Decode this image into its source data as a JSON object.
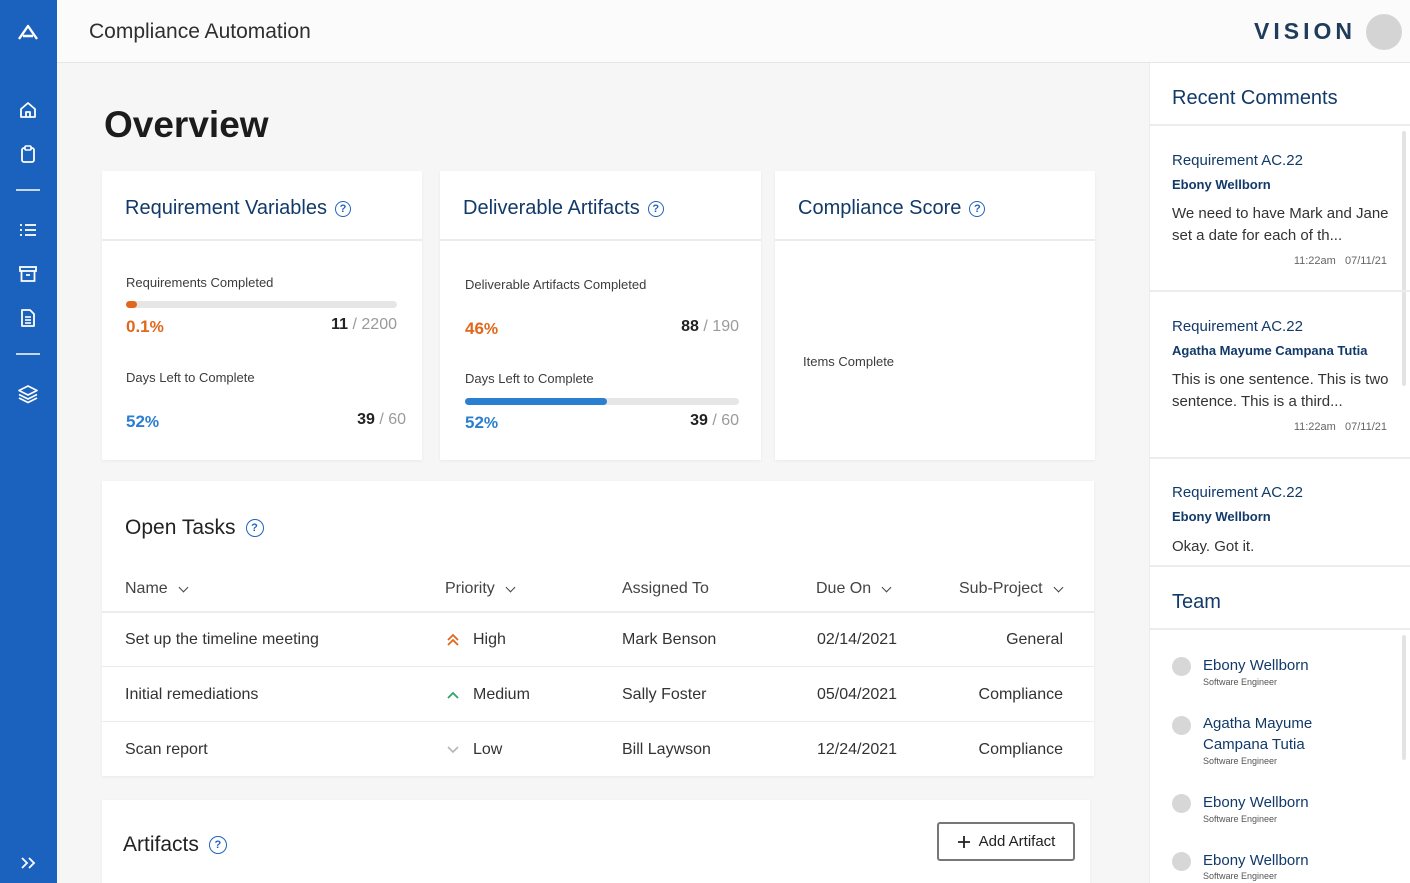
{
  "app": {
    "title": "Compliance Automation",
    "brand": "VISION"
  },
  "sidebar": {
    "icons": [
      "logo-icon",
      "home-icon",
      "clipboard-icon",
      "list-icon",
      "archive-icon",
      "document-icon",
      "layers-icon",
      "expand-icon"
    ]
  },
  "page": {
    "title": "Overview"
  },
  "req_vars": {
    "title": "Requirement Variables",
    "completed_label": "Requirements Completed",
    "completed_pct": "0.1",
    "completed_num": "11",
    "completed_total": "/ 2200",
    "completed_progress": 0.005,
    "days_label": "Days Left to Complete",
    "days_pct": "52",
    "days_num": "39",
    "days_total": "/ 60"
  },
  "deliverables": {
    "title": "Deliverable Artifacts",
    "completed_label": "Deliverable Artifacts Completed",
    "completed_pct": "46",
    "completed_num": "88",
    "completed_total": "/ 190",
    "days_label": "Days Left to Complete",
    "days_pct": "52",
    "days_num": "39",
    "days_total": "/ 60",
    "days_progress": 0.52
  },
  "compliance": {
    "title": "Compliance Score",
    "items_label": "Items Complete"
  },
  "percent_sign": "%",
  "tasks": {
    "title": "Open Tasks",
    "columns": {
      "name": "Name",
      "priority": "Priority",
      "assigned": "Assigned To",
      "due": "Due On",
      "sub": "Sub-Project"
    },
    "rows": [
      {
        "name": "Set up the timeline meeting",
        "priority": "High",
        "assigned": "Mark Benson",
        "due": "02/14/2021",
        "sub": "General"
      },
      {
        "name": "Initial remediations",
        "priority": "Medium",
        "assigned": "Sally Foster",
        "due": "05/04/2021",
        "sub": "Compliance"
      },
      {
        "name": "Scan report",
        "priority": "Low",
        "assigned": "Bill Laywson",
        "due": "12/24/2021",
        "sub": "Compliance"
      }
    ]
  },
  "artifacts": {
    "title": "Artifacts",
    "add_label": "Add Artifact"
  },
  "comments": {
    "title": "Recent Comments",
    "items": [
      {
        "req": "Requirement AC.22",
        "author": "Ebony Wellborn",
        "text": "We need to have Mark and Jane set a date for each of th...",
        "time": "11:22am",
        "date": "07/11/21"
      },
      {
        "req": "Requirement AC.22",
        "author": "Agatha Mayume Campana Tutia",
        "text": "This is one sentence. This is two sentence. This is a third...",
        "time": "11:22am",
        "date": "07/11/21"
      },
      {
        "req": "Requirement AC.22",
        "author": "Ebony Wellborn",
        "text": "Okay. Got it."
      }
    ]
  },
  "team": {
    "title": "Team",
    "members": [
      {
        "name": "Ebony Wellborn",
        "role": "Software Engineer"
      },
      {
        "name": "Agatha Mayume Campana Tutia",
        "role": "Software Engineer"
      },
      {
        "name": "Ebony Wellborn",
        "role": "Software Engineer"
      },
      {
        "name": "Ebony Wellborn",
        "role": "Software Engineer"
      }
    ]
  },
  "colors": {
    "primary": "#1a62be",
    "navy": "#123a69",
    "orange": "#e0671c",
    "blue": "#2a7fd0",
    "green": "#2ea36b"
  }
}
